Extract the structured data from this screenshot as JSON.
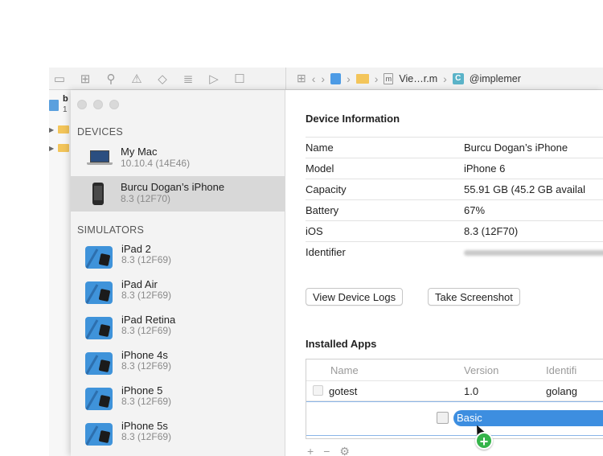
{
  "navigator": {
    "toolbar_icons": [
      "folder-icon",
      "hierarchy-icon",
      "search-icon",
      "warning-icon",
      "diamond-icon",
      "list-icon",
      "tag-icon",
      "message-icon"
    ],
    "project_name": "b",
    "project_sub": "1"
  },
  "jumpbar": {
    "file_label": "Vie…r.m",
    "symbol_label": "@implemer",
    "class_letter": "C",
    "m_letter": "m"
  },
  "sidebar": {
    "devices_label": "DEVICES",
    "devices": [
      {
        "name": "My Mac",
        "sub": "10.10.4 (14E46)",
        "icon": "mac-icon"
      },
      {
        "name": "Burcu Dogan’s iPhone",
        "sub": "8.3 (12F70)",
        "icon": "iphone-icon",
        "selected": true
      }
    ],
    "simulators_label": "SIMULATORS",
    "simulators": [
      {
        "name": "iPad 2",
        "sub": "8.3 (12F69)"
      },
      {
        "name": "iPad Air",
        "sub": "8.3 (12F69)"
      },
      {
        "name": "iPad Retina",
        "sub": "8.3 (12F69)"
      },
      {
        "name": "iPhone 4s",
        "sub": "8.3 (12F69)"
      },
      {
        "name": "iPhone 5",
        "sub": "8.3 (12F69)"
      },
      {
        "name": "iPhone 5s",
        "sub": "8.3 (12F69)"
      }
    ]
  },
  "device_info": {
    "heading": "Device Information",
    "rows": [
      {
        "key": "Name",
        "value": "Burcu Dogan’s iPhone"
      },
      {
        "key": "Model",
        "value": "iPhone 6"
      },
      {
        "key": "Capacity",
        "value": "55.91 GB (45.2 GB availal"
      },
      {
        "key": "Battery",
        "value": "67%"
      },
      {
        "key": "iOS",
        "value": "8.3 (12F70)"
      },
      {
        "key": "Identifier",
        "value": ""
      }
    ]
  },
  "buttons": {
    "view_logs": "View Device Logs",
    "screenshot": "Take Screenshot"
  },
  "installed_apps": {
    "heading": "Installed Apps",
    "columns": [
      "Name",
      "Version",
      "Identifi"
    ],
    "apps": [
      {
        "name": "gotest",
        "version": "1.0",
        "identifier": "golang"
      }
    ],
    "dragged_item": "Basic",
    "footer": {
      "add": "+",
      "remove": "−",
      "gear": "⚙"
    }
  }
}
